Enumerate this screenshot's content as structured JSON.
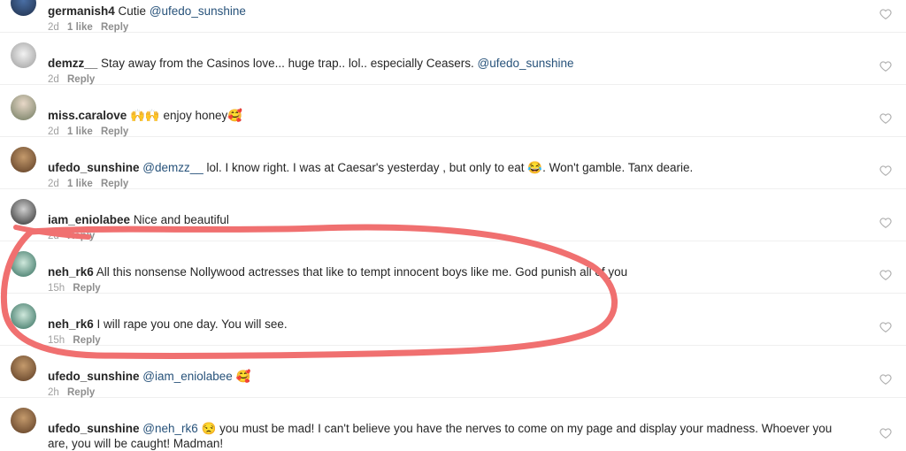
{
  "comments": [
    {
      "user": "germanish4",
      "pre": "Cutie ",
      "mention": "@ufedo_sunshine",
      "post": "",
      "time": "2d",
      "likes": "1 like",
      "reply": "Reply"
    },
    {
      "user": "demzz__",
      "pre": "Stay away from the Casinos love... huge trap.. lol.. especially Ceasers. ",
      "mention": "@ufedo_sunshine",
      "post": "",
      "time": "2d",
      "likes": "",
      "reply": "Reply"
    },
    {
      "user": "miss.caralove",
      "pre": "🙌🙌 enjoy honey🥰",
      "mention": "",
      "post": "",
      "time": "2d",
      "likes": "1 like",
      "reply": "Reply"
    },
    {
      "user": "ufedo_sunshine",
      "pre": "",
      "mention": "@demzz__",
      "post": " lol. I know right. I was at Caesar's yesterday , but only to eat 😂. Won't gamble. Tanx dearie.",
      "time": "2d",
      "likes": "1 like",
      "reply": "Reply"
    },
    {
      "user": "iam_eniolabee",
      "pre": "Nice and beautiful",
      "mention": "",
      "post": "",
      "time": "2d",
      "likes": "",
      "reply": "Reply"
    },
    {
      "user": "neh_rk6",
      "pre": "All this  nonsense Nollywood actresses that like to tempt innocent boys like me. God punish all of you",
      "mention": "",
      "post": "",
      "time": "15h",
      "likes": "",
      "reply": "Reply"
    },
    {
      "user": "neh_rk6",
      "pre": "I will rape you one day. You will see.",
      "mention": "",
      "post": "",
      "time": "15h",
      "likes": "",
      "reply": "Reply"
    },
    {
      "user": "ufedo_sunshine",
      "pre": "",
      "mention": "@iam_eniolabee",
      "post": " 🥰",
      "time": "2h",
      "likes": "",
      "reply": "Reply"
    },
    {
      "user": "ufedo_sunshine",
      "pre": "",
      "mention": "@neh_rk6",
      "post": " 😒 you must be mad!  I can't believe you have the nerves to come on my page and display your madness. Whoever you are, you will be caught! Madman!",
      "time": "",
      "likes": "",
      "reply": ""
    }
  ],
  "colors": {
    "accent_mention": "#27527a",
    "annotation_stroke": "#f07070",
    "heart_icon": "#b0b0b0"
  },
  "icons": {
    "like": "heart-icon",
    "avatar": "avatar"
  }
}
